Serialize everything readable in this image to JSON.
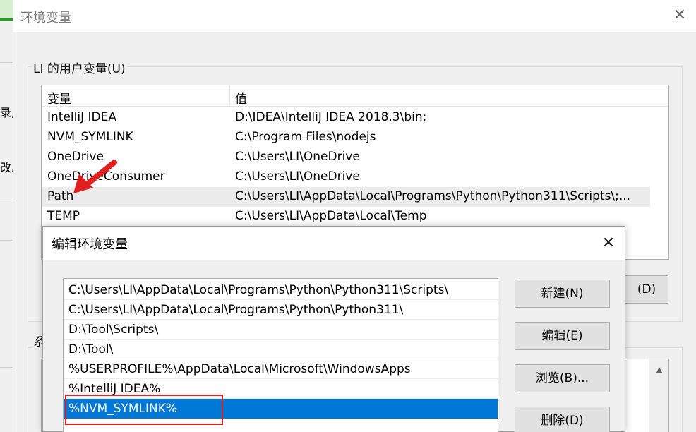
{
  "background_window": {
    "fragments": [
      "录,",
      "改虚"
    ]
  },
  "main_dialog": {
    "title": "环境变量",
    "close_glyph": "✕",
    "user_vars": {
      "group_label": "LI 的用户变量(U)",
      "columns": [
        "变量",
        "值"
      ],
      "rows": [
        {
          "name": "IntelliJ IDEA",
          "value": "D:\\IDEA\\IntelliJ IDEA 2018.3\\bin;"
        },
        {
          "name": "NVM_SYMLINK",
          "value": "C:\\Program Files\\nodejs"
        },
        {
          "name": "OneDrive",
          "value": "C:\\Users\\LI\\OneDrive"
        },
        {
          "name": "OneDriveConsumer",
          "value": "C:\\Users\\LI\\OneDrive"
        },
        {
          "name": "Path",
          "value": "C:\\Users\\LI\\AppData\\Local\\Programs\\Python\\Python311\\Scripts\\;..."
        },
        {
          "name": "TEMP",
          "value": "C:\\Users\\LI\\AppData\\Local\\Temp"
        }
      ],
      "highlighted_row": "Path",
      "delete_button_partial": "(D)"
    },
    "system_vars": {
      "group_label_partial": "系",
      "scroll_up_glyph": "▲"
    }
  },
  "edit_dialog": {
    "title": "编辑环境变量",
    "close_glyph": "✕",
    "paths": [
      "C:\\Users\\LI\\AppData\\Local\\Programs\\Python\\Python311\\Scripts\\",
      "C:\\Users\\LI\\AppData\\Local\\Programs\\Python\\Python311\\",
      "D:\\Tool\\Scripts\\",
      "D:\\Tool\\",
      "%USERPROFILE%\\AppData\\Local\\Microsoft\\WindowsApps",
      "%IntelliJ IDEA%",
      "%NVM_SYMLINK%"
    ],
    "selected_path": "%NVM_SYMLINK%",
    "buttons": {
      "new": "新建(N)",
      "edit": "编辑(E)",
      "browse": "浏览(B)...",
      "delete": "删除(D)"
    }
  },
  "annotations": {
    "arrow_color": "#e02020",
    "box_color": "#e02020"
  },
  "colors": {
    "selection": "#0078d7",
    "row_highlight": "#ececec",
    "dialog_bg": "#f0f0f0"
  }
}
